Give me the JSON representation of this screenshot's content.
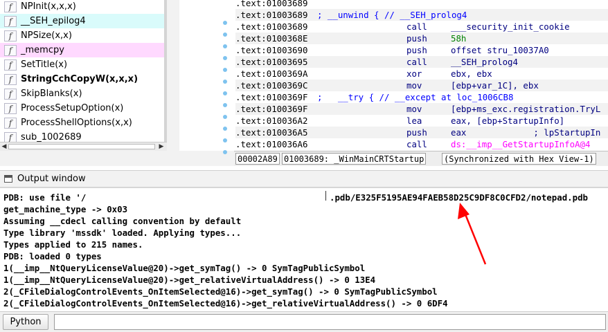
{
  "functions": {
    "items": [
      {
        "icon": "f",
        "name": "NPInit(x,x,x)",
        "style": "normal"
      },
      {
        "icon": "f",
        "name": "__SEH_epilog4",
        "style": "lib"
      },
      {
        "icon": "f",
        "name": "NPSize(x,x)",
        "style": "normal"
      },
      {
        "icon": "f",
        "name": "_memcpy",
        "style": "lib2"
      },
      {
        "icon": "f",
        "name": "SetTitle(x)",
        "style": "normal"
      },
      {
        "icon": "f",
        "name": "StringCchCopyW(x,x,x)",
        "style": "bold"
      },
      {
        "icon": "f",
        "name": "SkipBlanks(x)",
        "style": "normal"
      },
      {
        "icon": "f",
        "name": "ProcessSetupOption(x)",
        "style": "normal"
      },
      {
        "icon": "f",
        "name": "ProcessShellOptions(x,x)",
        "style": "normal"
      },
      {
        "icon": "f",
        "name": "sub_1002689",
        "style": "normal"
      }
    ],
    "scroll_left": "◀",
    "scroll_right": "▶"
  },
  "disassembly": {
    "lines": [
      {
        "addr": ".text:01003689",
        "comment": "",
        "mnemonic": "",
        "operand": ""
      },
      {
        "addr": ".text:01003689",
        "comment": "; __unwind { // __SEH_prolog4",
        "mnemonic": "",
        "operand": ""
      },
      {
        "addr": ".text:01003689",
        "comment": "",
        "mnemonic": "call",
        "operand": "___security_init_cookie"
      },
      {
        "addr": ".text:0100368E",
        "comment": "",
        "mnemonic": "push",
        "operand": "58h"
      },
      {
        "addr": ".text:01003690",
        "comment": "",
        "mnemonic": "push",
        "operand": "offset stru_10037A0"
      },
      {
        "addr": ".text:01003695",
        "comment": "",
        "mnemonic": "call",
        "operand": "__SEH_prolog4"
      },
      {
        "addr": ".text:0100369A",
        "comment": "",
        "mnemonic": "xor",
        "operand": "ebx, ebx"
      },
      {
        "addr": ".text:0100369C",
        "comment": "",
        "mnemonic": "mov",
        "operand": "[ebp+var_1C], ebx"
      },
      {
        "addr": ".text:0100369F",
        "comment": ";   __try { // __except at loc_1006CB8",
        "mnemonic": "",
        "operand": ""
      },
      {
        "addr": ".text:0100369F",
        "comment": "",
        "mnemonic": "mov",
        "operand": "[ebp+ms_exc.registration.TryL"
      },
      {
        "addr": ".text:010036A2",
        "comment": "",
        "mnemonic": "lea",
        "operand": "eax, [ebp+StartupInfo]"
      },
      {
        "addr": ".text:010036A5",
        "comment": "",
        "mnemonic": "push",
        "operand": "eax             ; lpStartupIn"
      },
      {
        "addr": ".text:010036A6",
        "comment": "",
        "mnemonic": "call",
        "operand": "ds:__imp__GetStartupInfoA@4"
      }
    ],
    "status": {
      "offset": "00002A89",
      "location": "01003689: _WinMainCRTStartup",
      "sync": "(Synchronized with Hex View-1)"
    }
  },
  "output_window": {
    "title": "Output window",
    "lines": [
      "PDB: use file '/",
      "get_machine_type -> 0x03",
      "Assuming __cdecl calling convention by default",
      "Type library 'mssdk' loaded. Applying types...",
      "Types applied to 215 names.",
      "PDB: loaded 0 types",
      "1(__imp__NtQueryLicenseValue@20)->get_symTag() -> 0 SymTagPublicSymbol",
      "1(__imp__NtQueryLicenseValue@20)->get_relativeVirtualAddress() -> 0 13E4",
      "2(_CFileDialogControlEvents_OnItemSelected@16)->get_symTag() -> 0 SymTagPublicSymbol",
      "2(_CFileDialogControlEvents_OnItemSelected@16)->get_relativeVirtualAddress() -> 0 6DF4"
    ],
    "pdb_tail": ".pdb/E325F5195AE94FAEB58D25C9DF8C0CFD2/notepad.pdb"
  },
  "command_bar": {
    "language_button": "Python",
    "input_value": ""
  },
  "colors": {
    "annotation_arrow": "#ff0000",
    "comment": "#0000ff",
    "code": "#000080",
    "import": "#ff00ff",
    "number": "#008000",
    "lib_bg": "#d9fbfb",
    "lib2_bg": "#ffd9ff"
  }
}
